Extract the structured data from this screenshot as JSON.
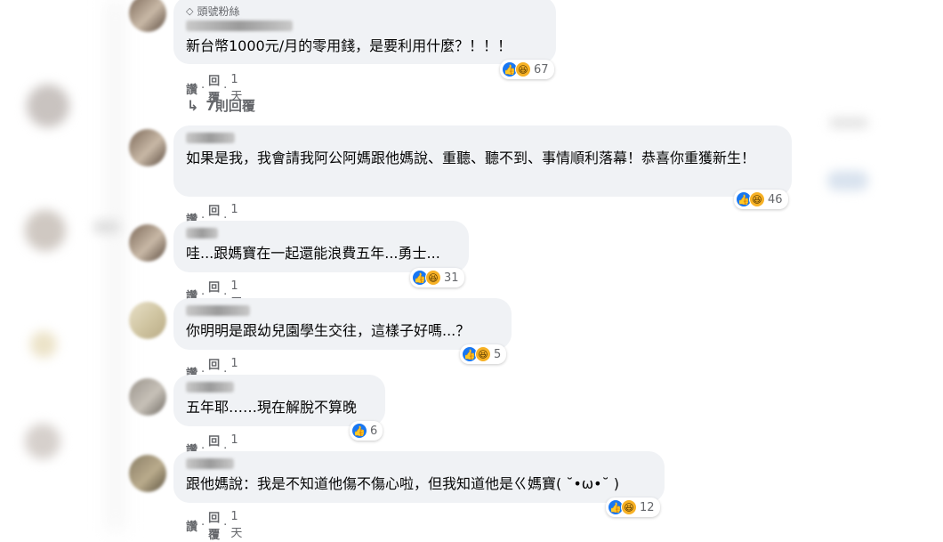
{
  "comments": [
    {
      "badge": "頭號粉絲",
      "text": "新台幣1000元/月的零用錢，是要利用什麼？！！！",
      "reactions": {
        "count": "67",
        "types": [
          "like-icon",
          "haha-icon"
        ]
      },
      "actions": {
        "like": "讚",
        "reply": "回覆",
        "time": "1天"
      }
    },
    {
      "text": "如果是我，我會請我阿公阿媽跟他媽說、重聽、聽不到、事情順利落幕！恭喜你重獲新生！",
      "reactions": {
        "count": "46",
        "types": [
          "like-icon",
          "haha-icon"
        ]
      },
      "actions": {
        "like": "讚",
        "reply": "回覆",
        "time": "1天"
      }
    },
    {
      "text": "哇...跟媽寶在一起還能浪費五年...勇士...",
      "reactions": {
        "count": "31",
        "types": [
          "like-icon",
          "haha-icon"
        ]
      },
      "actions": {
        "like": "讚",
        "reply": "回覆",
        "time": "1天"
      }
    },
    {
      "text": "你明明是跟幼兒園學生交往，這樣子好嗎...？",
      "reactions": {
        "count": "5",
        "types": [
          "like-icon",
          "haha-icon"
        ]
      },
      "actions": {
        "like": "讚",
        "reply": "回覆",
        "time": "1天"
      }
    },
    {
      "text": "五年耶……現在解脫不算晚",
      "reactions": {
        "count": "6",
        "types": [
          "like-icon"
        ]
      },
      "actions": {
        "like": "讚",
        "reply": "回覆",
        "time": "1天"
      }
    },
    {
      "text": "跟他媽說：我是不知道他傷不傷心啦，但我知道他是ㄍ媽寶( ˘•ω•˘ )",
      "reactions": {
        "count": "12",
        "types": [
          "like-icon",
          "haha-icon"
        ]
      },
      "actions": {
        "like": "讚",
        "reply": "回覆",
        "time": "1天"
      }
    }
  ],
  "view_replies": {
    "arrow": "↳",
    "label": "7則回覆"
  },
  "separator": "·",
  "colors": {
    "bubble": "#f0f2f5",
    "like": "#1877f2",
    "haha": "#f7b125",
    "meta": "#65676b"
  }
}
